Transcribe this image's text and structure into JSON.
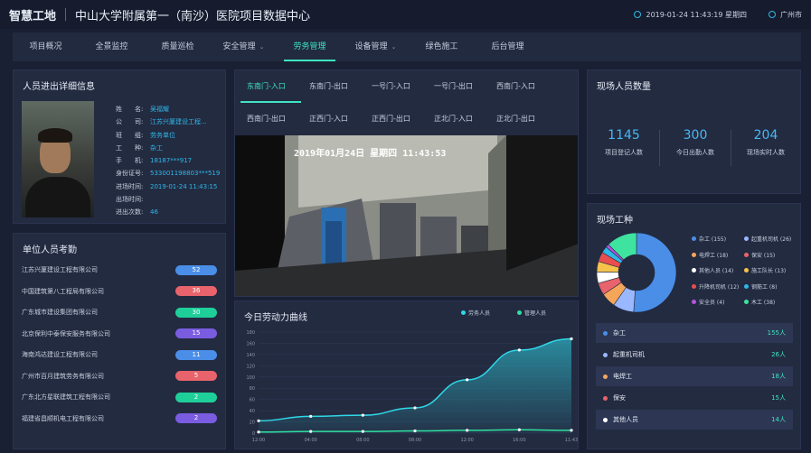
{
  "header": {
    "brand": "智慧工地",
    "project": "中山大学附属第一（南沙）医院项目数据中心",
    "datetime": "2019-01-24 11:43:19 星期四",
    "city": "广州市"
  },
  "nav": [
    {
      "label": "项目概况",
      "active": false,
      "dropdown": false
    },
    {
      "label": "全景监控",
      "active": false,
      "dropdown": false
    },
    {
      "label": "质量巡检",
      "active": false,
      "dropdown": false
    },
    {
      "label": "安全管理",
      "active": false,
      "dropdown": true
    },
    {
      "label": "劳务管理",
      "active": true,
      "dropdown": false
    },
    {
      "label": "设备管理",
      "active": false,
      "dropdown": true
    },
    {
      "label": "绿色施工",
      "active": false,
      "dropdown": false
    },
    {
      "label": "后台管理",
      "active": false,
      "dropdown": false
    }
  ],
  "person": {
    "title": "人员进出详细信息",
    "fields": [
      {
        "k": "姓　　名:",
        "v": "吴福耀"
      },
      {
        "k": "公　　司:",
        "v": "江苏兴厦建设工程..."
      },
      {
        "k": "班　　组:",
        "v": "劳务单位"
      },
      {
        "k": "工　　种:",
        "v": "杂工"
      },
      {
        "k": "手　　机:",
        "v": "18187***917"
      },
      {
        "k": "身份证号:",
        "v": "533001198803***519"
      },
      {
        "k": "进场时间:",
        "v": "2019-01-24 11:43:15"
      },
      {
        "k": "出场时间:",
        "v": ""
      },
      {
        "k": "进出次数:",
        "v": "46"
      }
    ]
  },
  "attendance": {
    "title": "单位人员考勤",
    "rows": [
      {
        "name": "江苏兴厦建设工程有限公司",
        "count": "52",
        "color": "#4a8ee8"
      },
      {
        "name": "中国建筑第八工程局有限公司",
        "count": "36",
        "color": "#e8636b"
      },
      {
        "name": "广东城市建设集团有限公司",
        "count": "30",
        "color": "#1fcf9a"
      },
      {
        "name": "北京保利中泰保安服务有限公司",
        "count": "15",
        "color": "#7a5ce0"
      },
      {
        "name": "海南鸿达建设工程有限公司",
        "count": "11",
        "color": "#4a8ee8"
      },
      {
        "name": "广州市百月建筑劳务有限公司",
        "count": "5",
        "color": "#e8636b"
      },
      {
        "name": "广东北方星联建筑工程有限公司",
        "count": "2",
        "color": "#1fcf9a"
      },
      {
        "name": "福建省昌顺机电工程有限公司",
        "count": "2",
        "color": "#7a5ce0"
      }
    ]
  },
  "gates": {
    "row1": [
      "东南门-入口",
      "东南门-出口",
      "一号门-入口",
      "一号门-出口",
      "西南门-入口"
    ],
    "row2": [
      "西南门-出口",
      "正西门-入口",
      "正西门-出口",
      "正北门-入口",
      "正北门-出口"
    ],
    "active": "东南门-入口",
    "video_timestamp": "2019年01月24日  星期四  11:43:53"
  },
  "curve": {
    "title": "今日劳动力曲线",
    "legend": [
      {
        "name": "劳务人员",
        "color": "#2fd8e8"
      },
      {
        "name": "管理人员",
        "color": "#2fe0a0"
      }
    ]
  },
  "chart_data": {
    "type": "line",
    "x": [
      "12:00",
      "04:00",
      "08:00",
      "08:00",
      "12:00",
      "16:00",
      "11:43"
    ],
    "yticks": [
      "0",
      "20",
      "40",
      "60",
      "80",
      "100",
      "120",
      "140",
      "160",
      "180"
    ],
    "ylim": [
      0,
      180
    ],
    "series": [
      {
        "name": "劳务人员",
        "values": [
          22,
          30,
          32,
          45,
          95,
          148,
          168
        ]
      },
      {
        "name": "管理人员",
        "values": [
          2,
          3,
          3,
          4,
          5,
          6,
          5
        ]
      }
    ]
  },
  "onsite": {
    "title": "现场人员数量",
    "stats": [
      {
        "n": "1145",
        "l": "项目登记人数"
      },
      {
        "n": "300",
        "l": "今日出勤人数"
      },
      {
        "n": "204",
        "l": "现场实时人数"
      }
    ]
  },
  "workers": {
    "title": "现场工种",
    "legend": [
      {
        "name": "杂工 (155)",
        "color": "#4a8ee8"
      },
      {
        "name": "起重机司机 (26)",
        "color": "#9ab8ff"
      },
      {
        "name": "电焊工 (18)",
        "color": "#f5a65b"
      },
      {
        "name": "保安 (15)",
        "color": "#e8636b"
      },
      {
        "name": "其他人员 (14)",
        "color": "#ffffff"
      },
      {
        "name": "施工队长 (13)",
        "color": "#f5c24b"
      },
      {
        "name": "升降机司机 (12)",
        "color": "#e84e4e"
      },
      {
        "name": "钢筋工 (8)",
        "color": "#2fb7e8"
      },
      {
        "name": "安全员 (4)",
        "color": "#b455e0"
      },
      {
        "name": "木工 (38)",
        "color": "#3ee3a0"
      }
    ],
    "pie": [
      155,
      26,
      18,
      15,
      14,
      13,
      12,
      8,
      4,
      38
    ],
    "rows": [
      {
        "name": "杂工",
        "count": "155人",
        "color": "#4a8ee8"
      },
      {
        "name": "起重机司机",
        "count": "26人",
        "color": "#9ab8ff"
      },
      {
        "name": "电焊工",
        "count": "18人",
        "color": "#f5a65b"
      },
      {
        "name": "保安",
        "count": "15人",
        "color": "#e8636b"
      },
      {
        "name": "其他人员",
        "count": "14人",
        "color": "#ffffff"
      }
    ]
  }
}
